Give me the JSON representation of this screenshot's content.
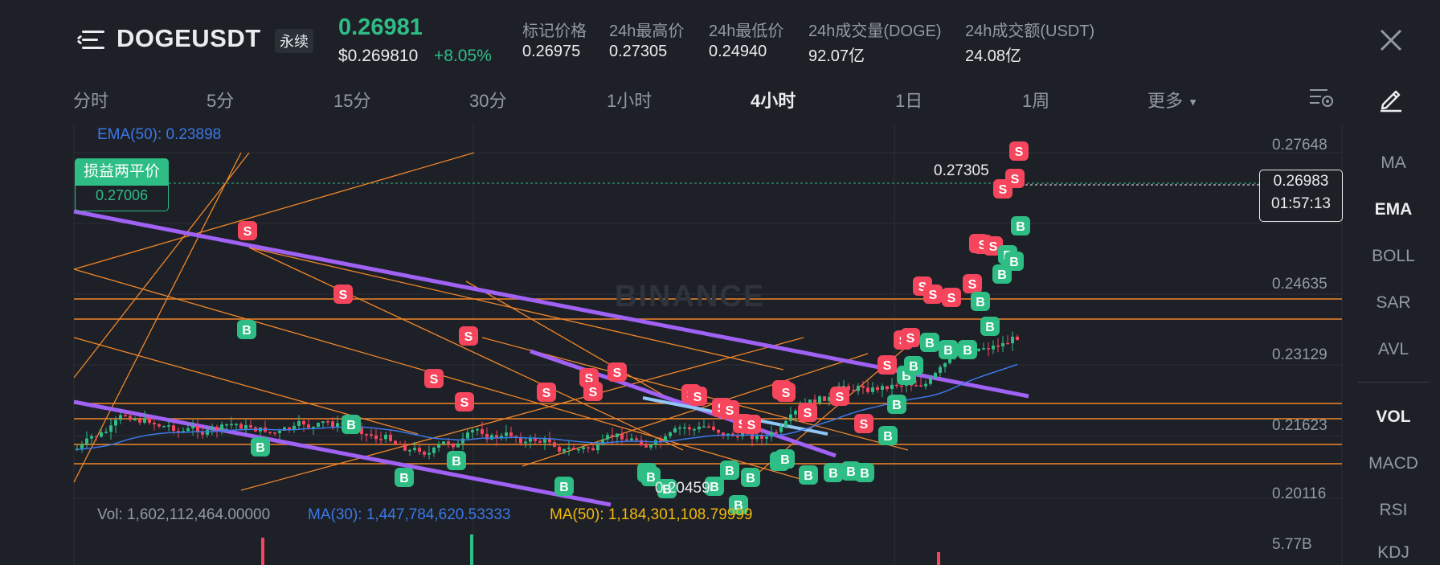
{
  "header": {
    "symbol": "DOGEUSDT",
    "contract_type": "永续",
    "last_price": "0.26981",
    "usd_price": "$0.269810",
    "change_pct": "+8.05%",
    "stats": [
      {
        "label": "标记价格",
        "value": "0.26975"
      },
      {
        "label": "24h最高价",
        "value": "0.27305"
      },
      {
        "label": "24h最低价",
        "value": "0.24940"
      },
      {
        "label": "24h成交量(DOGE)",
        "value": "92.07亿"
      },
      {
        "label": "24h成交额(USDT)",
        "value": "24.08亿"
      }
    ]
  },
  "intervals": [
    "分时",
    "5分",
    "15分",
    "30分",
    "1小时",
    "4小时",
    "1日",
    "1周",
    "更多"
  ],
  "active_interval": "4小时",
  "indicators": [
    "MA",
    "EMA",
    "BOLL",
    "SAR",
    "AVL",
    "VOL",
    "MACD",
    "RSI",
    "KDJ"
  ],
  "active_indicators": [
    "EMA",
    "VOL"
  ],
  "chart": {
    "ema_label": "EMA(50): 0.23898",
    "pnl_title": "损益两平价",
    "pnl_value": "0.27006",
    "price_axis": [
      "0.27648",
      "0.24635",
      "0.23129",
      "0.21623",
      "0.20116"
    ],
    "current_price": "0.26983",
    "countdown": "01:57:13",
    "high_marker": "0.27305",
    "low_marker": "0.20459",
    "watermark": "BINANCE",
    "buy_marker": "B",
    "sell_marker": "S",
    "vol_axis": "5.77B"
  },
  "volume": {
    "vol": "Vol: 1,602,112,464.00000",
    "ma30": "MA(30): 1,447,784,620.53333",
    "ma50": "MA(50): 1,184,301,108.79999"
  },
  "colors": {
    "up": "#2ebd85",
    "down": "#f6465d",
    "ema": "#3b78e7",
    "trendline": "#f0862a",
    "channel": "#a061f5",
    "ma50": "#f0b90b"
  },
  "icons": {
    "menu": "menu-icon",
    "close": "close-icon",
    "settings": "chart-settings-icon",
    "draw": "pencil-icon",
    "dropdown": "chevron-down-icon"
  }
}
